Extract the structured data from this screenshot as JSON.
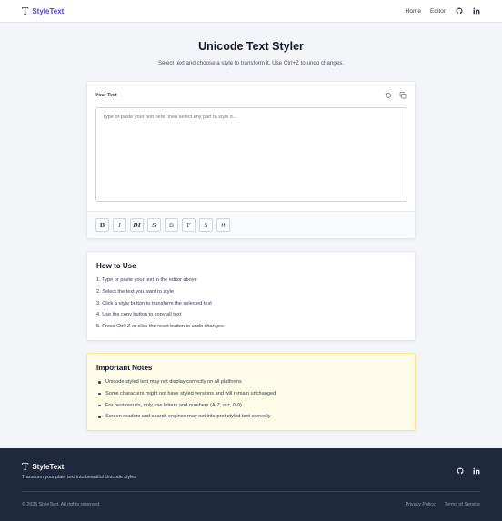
{
  "nav": {
    "brand_icon": "T",
    "brand": "StyleText",
    "links": [
      "Home",
      "Editor"
    ],
    "icons": [
      "github-icon",
      "linkedin-icon"
    ]
  },
  "hero": {
    "title": "Unicode Text Styler",
    "subtitle": "Select text and choose a style to transform it. Use Ctrl+Z to undo changes."
  },
  "editor": {
    "label": "Your Text",
    "placeholder": "Type or paste your text here, then select any part to style it...",
    "tools": [
      "reset-icon",
      "copy-icon"
    ],
    "styles": [
      "B",
      "I",
      "BI",
      "S",
      "D",
      "F",
      "S",
      "M"
    ]
  },
  "howto": {
    "title": "How to Use",
    "steps": [
      "1. Type or paste your text in the editor above",
      "2. Select the text you want to style",
      "3. Click a style button to transform the selected text",
      "4. Use the copy button to copy all text",
      "5. Press Ctrl+Z or click the reset button to undo changes"
    ]
  },
  "notes": {
    "title": "Important Notes",
    "items": [
      "Unicode styled text may not display correctly on all platforms",
      "Some characters might not have styled versions and will remain unchanged",
      "For best results, only use letters and numbers (A-Z, a-z, 0-9)",
      "Screen readers and search engines may not interpret styled text correctly"
    ]
  },
  "footer": {
    "brand_icon": "T",
    "brand": "StyleText",
    "tagline": "Transform your plain text into beautiful Unicode styles",
    "copyright": "© 2025 StyleText. All rights reserved.",
    "links": [
      "Privacy Policy",
      "Terms of Service"
    ]
  },
  "colors": {
    "accent": "#5b3fd1",
    "footer_bg": "#1e293b",
    "notes_bg": "#fefce8"
  }
}
